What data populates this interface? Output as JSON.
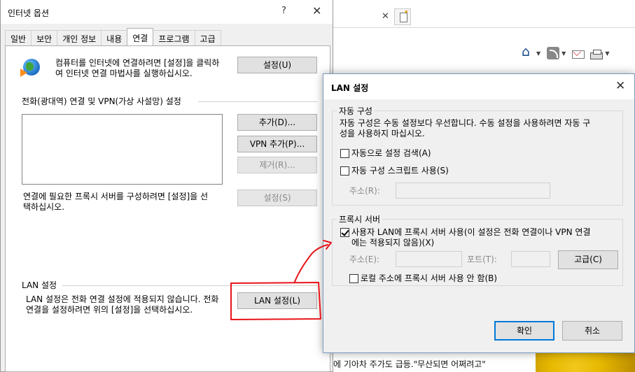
{
  "browser": {
    "article_text": "에 기아차 주가도 급등.\"무산되면 어쩌려고\""
  },
  "inet_options": {
    "title": "인터넷 옵션",
    "help_glyph": "?",
    "close_glyph": "✕",
    "tabs": [
      "일반",
      "보안",
      "개인 정보",
      "내용",
      "연결",
      "프로그램",
      "고급"
    ],
    "active_tab": "연결",
    "setup_text_line1": "컴퓨터를 인터넷에 연결하려면 [설정]을 클릭하",
    "setup_text_line2": "여 인터넷 연결 마법사를 실행하십시오.",
    "setup_button": "설정(U)",
    "dialup_group": "전화(광대역) 연결 및 VPN(가상 사설망) 설정",
    "add_button": "추가(D)...",
    "add_vpn_button": "VPN 추가(P)...",
    "remove_button": "제거(R)...",
    "proxy_text_line1": "연결에 필요한 프록시 서버를 구성하려면 [설정]을 선",
    "proxy_text_line2": "택하십시오.",
    "settings_button": "설정(S)",
    "lan_group": "LAN 설정",
    "lan_text_line1": "LAN 설정은 전화 연결 설정에 적용되지 않습니다. 전화",
    "lan_text_line2": "연결을 설정하려면 위의 [설정]을 선택하십시오.",
    "lan_button": "LAN 설정(L)"
  },
  "lan_dialog": {
    "title": "LAN 설정",
    "close_glyph": "✕",
    "auto_group": "자동 구성",
    "auto_desc_line1": "자동 구성은 수동 설정보다 우선합니다. 수동 설정을 사용하려면 자동 구",
    "auto_desc_line2": "성을 사용하지 마십시오.",
    "auto_detect_label": "자동으로 설정 검색(A)",
    "auto_detect_checked": false,
    "auto_script_label": "자동 구성 스크립트 사용(S)",
    "auto_script_checked": false,
    "address_label": "주소(R):",
    "address_value": "",
    "proxy_group": "프록시 서버",
    "use_proxy_label_line1": "사용자 LAN에 프록시 서버 사용(이 설정은 전화 연결이나 VPN 연결",
    "use_proxy_label_line2": "에는 적용되지 않음)(X)",
    "use_proxy_checked": true,
    "proxy_address_label": "주소(E):",
    "proxy_address_value": "",
    "port_label": "포트(T):",
    "port_value": "",
    "advanced_button": "고급(C)",
    "bypass_local_label": "로컬 주소에 프록시 서버 사용 안 함(B)",
    "bypass_local_checked": false,
    "ok_button": "확인",
    "cancel_button": "취소"
  },
  "colors": {
    "annotation_red": "#e8141a",
    "accent_blue": "#0078d7",
    "dialog_bg": "#f0f0f0"
  }
}
